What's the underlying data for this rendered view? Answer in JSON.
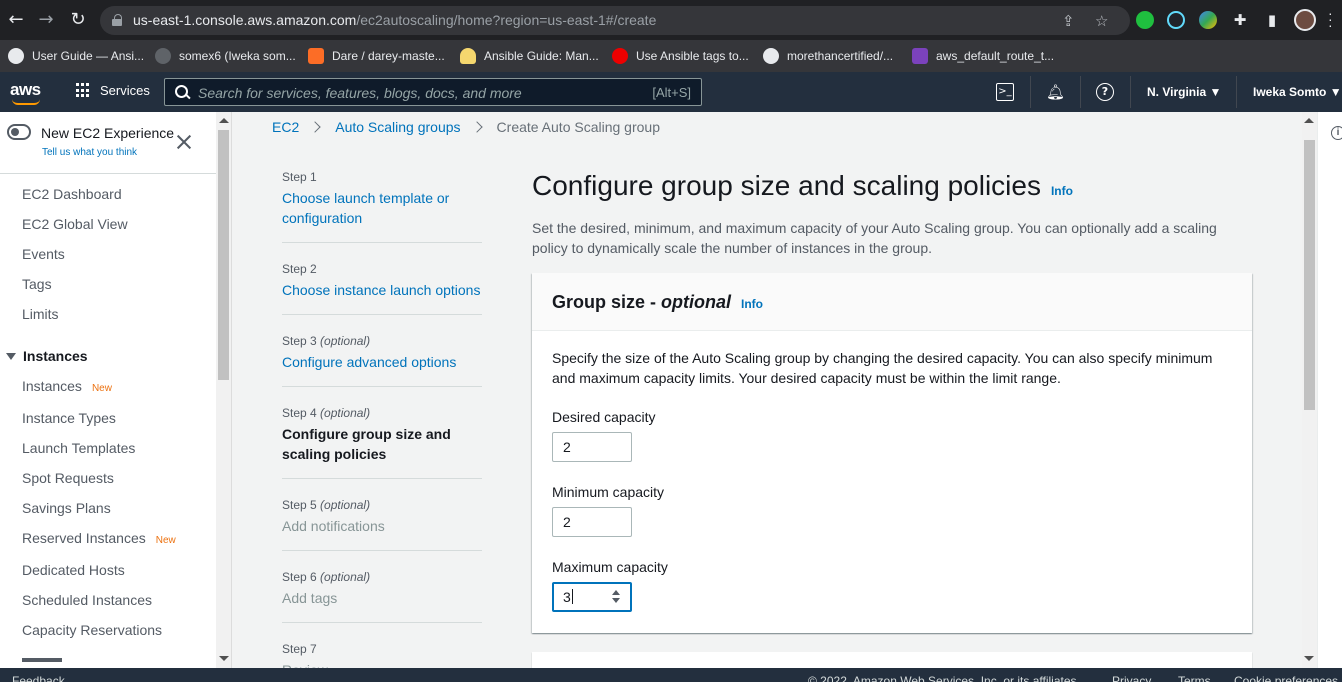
{
  "browser": {
    "url_host": "us-east-1.console.aws.amazon.com",
    "url_path": "/ec2autoscaling/home?region=us-east-1#/create",
    "bookmarks": [
      {
        "label": "User Guide — Ansi...",
        "icon": "aws-icon",
        "color": "#e8eaed"
      },
      {
        "label": "somex6 (Iweka som...",
        "icon": "avatar-icon",
        "color": "#5f6368"
      },
      {
        "label": "Dare / darey-maste...",
        "icon": "gitlab-icon",
        "color": "#fc6d26"
      },
      {
        "label": "Ansible Guide: Man...",
        "icon": "lightbulb-icon",
        "color": "#f5d76e"
      },
      {
        "label": "Use Ansible tags to...",
        "icon": "redhat-icon",
        "color": "#ee0000"
      },
      {
        "label": "morethancertified/...",
        "icon": "github-icon",
        "color": "#e8eaed"
      },
      {
        "label": "aws_default_route_t...",
        "icon": "terraform-icon",
        "color": "#7b42bc"
      }
    ]
  },
  "aws_header": {
    "logo": "aws",
    "services": "Services",
    "search_placeholder": "Search for services, features, blogs, docs, and more",
    "search_shortcut": "[Alt+S]",
    "region": "N. Virginia",
    "user": "Iweka Somto"
  },
  "sidebar": {
    "new_experience": "New EC2 Experience",
    "tell_us": "Tell us what you think",
    "items": [
      {
        "label": "EC2 Dashboard"
      },
      {
        "label": "EC2 Global View"
      },
      {
        "label": "Events"
      },
      {
        "label": "Tags"
      },
      {
        "label": "Limits"
      }
    ],
    "section": "Instances",
    "section_items": [
      {
        "label": "Instances",
        "badge": "New"
      },
      {
        "label": "Instance Types",
        "badge": ""
      },
      {
        "label": "Launch Templates",
        "badge": ""
      },
      {
        "label": "Spot Requests",
        "badge": ""
      },
      {
        "label": "Savings Plans",
        "badge": ""
      },
      {
        "label": "Reserved Instances",
        "badge": "New"
      },
      {
        "label": "Dedicated Hosts",
        "badge": ""
      },
      {
        "label": "Scheduled Instances",
        "badge": ""
      },
      {
        "label": "Capacity Reservations",
        "badge": ""
      }
    ]
  },
  "breadcrumb": {
    "items": [
      "EC2",
      "Auto Scaling groups",
      "Create Auto Scaling group"
    ]
  },
  "steps": [
    {
      "num": "Step 1",
      "optional": "",
      "title": "Choose launch template or configuration",
      "state": "link"
    },
    {
      "num": "Step 2",
      "optional": "",
      "title": "Choose instance launch options",
      "state": "link"
    },
    {
      "num": "Step 3",
      "optional": "(optional)",
      "title": "Configure advanced options",
      "state": "link"
    },
    {
      "num": "Step 4",
      "optional": "(optional)",
      "title": "Configure group size and scaling policies",
      "state": "active"
    },
    {
      "num": "Step 5",
      "optional": "(optional)",
      "title": "Add notifications",
      "state": "disabled"
    },
    {
      "num": "Step 6",
      "optional": "(optional)",
      "title": "Add tags",
      "state": "disabled"
    },
    {
      "num": "Step 7",
      "optional": "",
      "title": "Review",
      "state": "disabled"
    }
  ],
  "main": {
    "title": "Configure group size and scaling policies",
    "info": "Info",
    "description": "Set the desired, minimum, and maximum capacity of your Auto Scaling group. You can optionally add a scaling policy to dynamically scale the number of instances in the group."
  },
  "group_size": {
    "title": "Group size",
    "title_sep": " - ",
    "title_optional": "optional",
    "info": "Info",
    "description": "Specify the size of the Auto Scaling group by changing the desired capacity. You can also specify minimum and maximum capacity limits. Your desired capacity must be within the limit range.",
    "desired_label": "Desired capacity",
    "desired_value": "2",
    "minimum_label": "Minimum capacity",
    "minimum_value": "2",
    "maximum_label": "Maximum capacity",
    "maximum_value": "3"
  },
  "footer": {
    "feedback": "Feedback",
    "copyright": "© 2022, Amazon Web Services, Inc. or its affiliates.",
    "privacy": "Privacy",
    "terms": "Terms",
    "cookie": "Cookie preferences"
  }
}
